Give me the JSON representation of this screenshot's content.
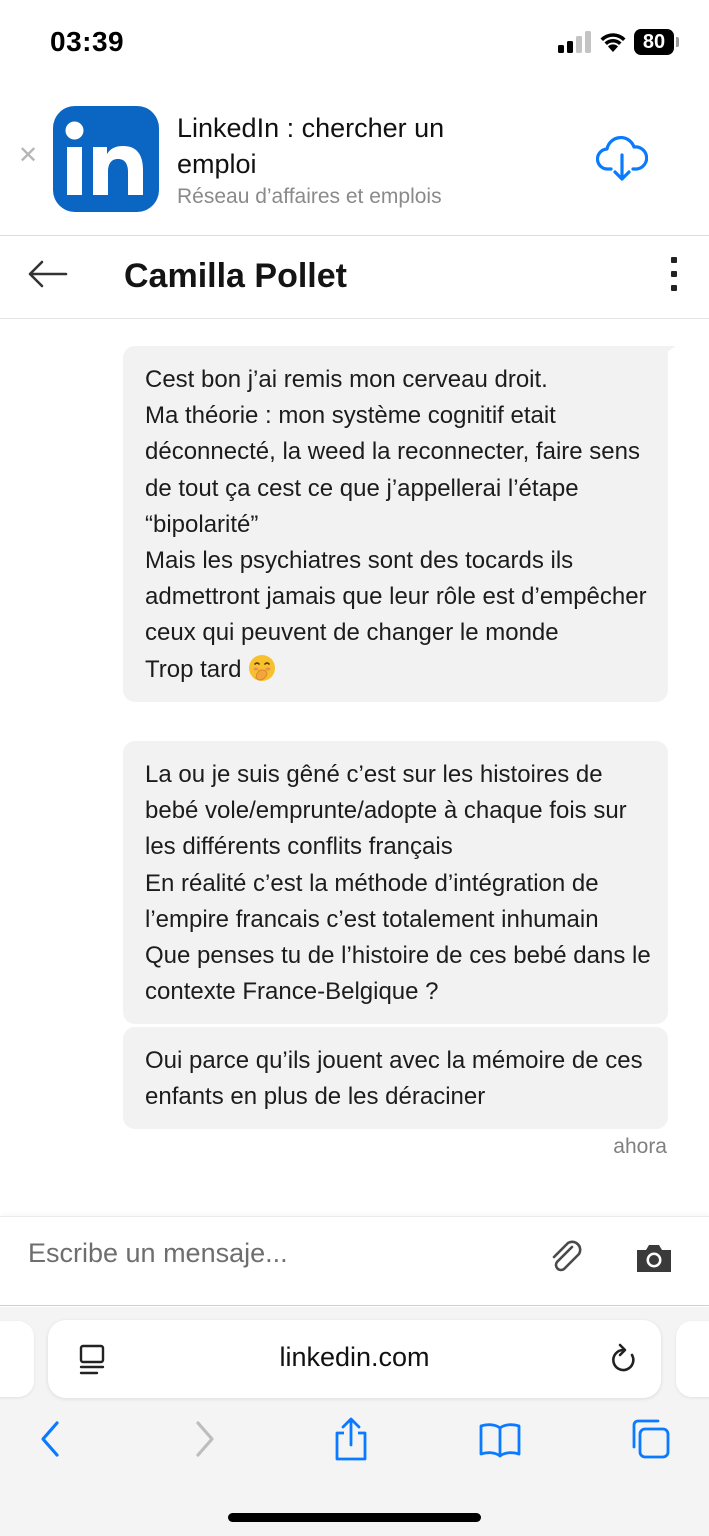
{
  "status_bar": {
    "time": "03:39",
    "battery": "80"
  },
  "app_banner": {
    "title": "LinkedIn : chercher un emploi",
    "subtitle": "Réseau d’affaires et emplois",
    "close_icon": "close-icon",
    "action_icon": "cloud-download-icon",
    "icon_text": "in",
    "brand_color": "#0a66c2"
  },
  "header": {
    "contact_name": "Camilla Pollet"
  },
  "messages": [
    {
      "text": "Cest bon j’ai remis mon cerveau droit.\nMa théorie : mon système cognitif etait déconnecté, la weed la reconnecter, faire sens de tout ça cest ce que j’appellerai l’étape “bipolarité”\nMais les psychiatres sont des tocards ils admettront jamais que leur rôle est d’empêcher ceux qui peuvent de changer le monde\nTrop tard",
      "emoji": "face-with-hand-over-mouth-emoji"
    },
    {
      "text": "La ou je suis gêné c’est sur les histoires de bebé vole/emprunte/adopte à chaque fois sur les différents conflits français\nEn réalité c’est la méthode d’intégration de l’empire francais c’est totalement inhumain\nQue penses tu de l’histoire de ces bebé dans le contexte France-Belgique ?"
    },
    {
      "text": "Oui parce qu’ils jouent avec la mémoire de ces enfants en plus de les déraciner"
    }
  ],
  "timestamp": "ahora",
  "compose": {
    "placeholder": "Escribe un mensaje..."
  },
  "browser": {
    "url": "linkedin.com",
    "accent_color": "#0a7aff"
  }
}
